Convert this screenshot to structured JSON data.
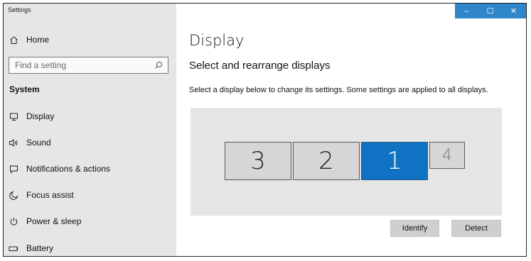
{
  "window": {
    "title": "Settings",
    "controls": {
      "minimize": "–",
      "maximize": "☐",
      "close": "✕"
    }
  },
  "sidebar": {
    "home": {
      "label": "Home",
      "icon": "home-icon"
    },
    "search": {
      "placeholder": "Find a setting",
      "icon": "search-icon"
    },
    "section_title": "System",
    "items": [
      {
        "label": "Display",
        "icon": "monitor-icon"
      },
      {
        "label": "Sound",
        "icon": "speaker-icon"
      },
      {
        "label": "Notifications & actions",
        "icon": "notification-icon"
      },
      {
        "label": "Focus assist",
        "icon": "moon-icon"
      },
      {
        "label": "Power & sleep",
        "icon": "power-icon"
      },
      {
        "label": "Battery",
        "icon": "battery-icon"
      }
    ]
  },
  "main": {
    "title": "Display",
    "subtitle": "Select and rearrange displays",
    "description": "Select a display below to change its settings. Some settings are applied to all displays.",
    "displays": [
      {
        "number": "3",
        "selected": false
      },
      {
        "number": "2",
        "selected": false
      },
      {
        "number": "1",
        "selected": true
      },
      {
        "number": "4",
        "selected": false
      }
    ],
    "buttons": {
      "identify": "Identify",
      "detect": "Detect"
    }
  },
  "colors": {
    "accent": "#0f72c2",
    "titlebar": "#2f86c9",
    "sidebar_bg": "#e6e6e6",
    "arrangement_bg": "#e5e5e5"
  }
}
